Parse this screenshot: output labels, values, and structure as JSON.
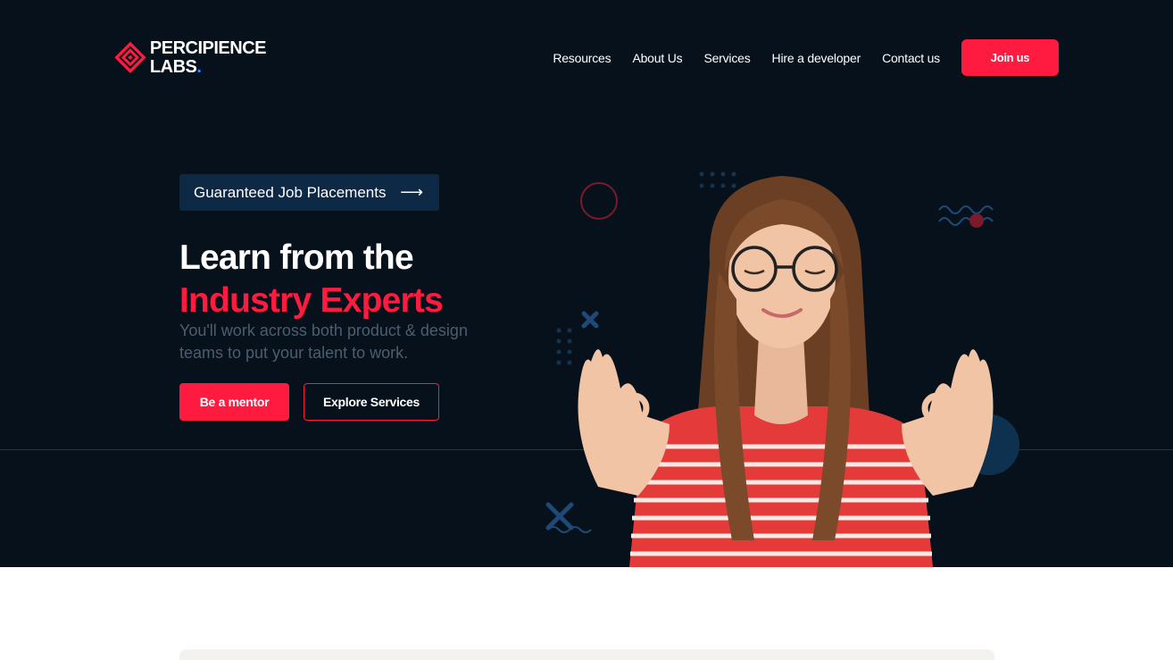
{
  "brand": {
    "line1": "PERCIPIENCE",
    "line2": "LABS",
    "dot": ".",
    "accent_color": "#ff1a3f",
    "dot_color": "#2f8cff",
    "background": "#07111b"
  },
  "nav": {
    "items": [
      {
        "label": "Resources"
      },
      {
        "label": "About Us"
      },
      {
        "label": "Services"
      },
      {
        "label": "Hire a developer"
      },
      {
        "label": "Contact us"
      }
    ],
    "cta_label": "Join us"
  },
  "hero": {
    "badge_label": "Guaranteed Job Placements",
    "badge_icon": "arrow-right-icon",
    "title_line1": "Learn from the",
    "title_line2": "Industry Experts",
    "subtitle": "You'll work across both product & design teams to put your talent to work.",
    "primary_button": "Be a mentor",
    "secondary_button": "Explore Services",
    "image": "woman-meditating-with-glasses-photo"
  }
}
